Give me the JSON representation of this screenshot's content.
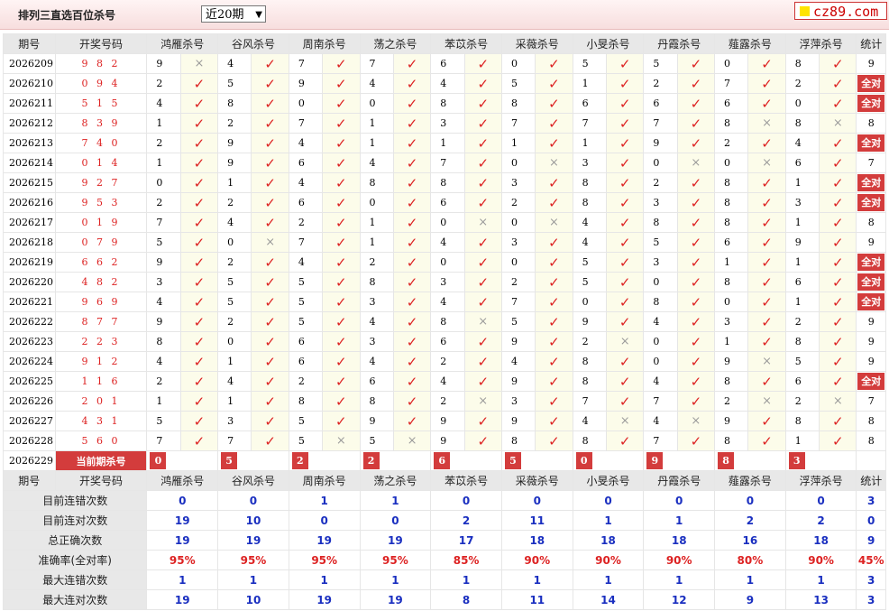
{
  "header": {
    "title": "排列三直选百位杀号",
    "period_select": "近20期",
    "logo": "cz89.com"
  },
  "columns": {
    "period": "期号",
    "draw": "开奖号码",
    "stat": "统计",
    "experts": [
      "鸿雁杀号",
      "谷风杀号",
      "周南杀号",
      "荡之杀号",
      "苯苡杀号",
      "采薇杀号",
      "小旻杀号",
      "丹霞杀号",
      "薤露杀号",
      "浮萍杀号"
    ]
  },
  "marks": {
    "correct": "✓",
    "wrong": "×",
    "all_correct": "全对"
  },
  "rows": [
    {
      "period": "2026209",
      "draw": "9 8 2",
      "kills": [
        "9",
        "4",
        "7",
        "7",
        "6",
        "0",
        "5",
        "5",
        "0",
        "8"
      ],
      "hits": [
        0,
        1,
        1,
        1,
        1,
        1,
        1,
        1,
        1,
        1
      ],
      "total": "9"
    },
    {
      "period": "2026210",
      "draw": "0 9 4",
      "kills": [
        "2",
        "5",
        "9",
        "4",
        "4",
        "5",
        "1",
        "2",
        "7",
        "2"
      ],
      "hits": [
        1,
        1,
        1,
        1,
        1,
        1,
        1,
        1,
        1,
        1
      ],
      "total": "全对"
    },
    {
      "period": "2026211",
      "draw": "5 1 5",
      "kills": [
        "4",
        "8",
        "0",
        "0",
        "8",
        "8",
        "6",
        "6",
        "6",
        "0"
      ],
      "hits": [
        1,
        1,
        1,
        1,
        1,
        1,
        1,
        1,
        1,
        1
      ],
      "total": "全对"
    },
    {
      "period": "2026212",
      "draw": "8 3 9",
      "kills": [
        "1",
        "2",
        "7",
        "1",
        "3",
        "7",
        "7",
        "7",
        "8",
        "8"
      ],
      "hits": [
        1,
        1,
        1,
        1,
        1,
        1,
        1,
        1,
        0,
        0
      ],
      "total": "8"
    },
    {
      "period": "2026213",
      "draw": "7 4 0",
      "kills": [
        "2",
        "9",
        "4",
        "1",
        "1",
        "1",
        "1",
        "9",
        "2",
        "4"
      ],
      "hits": [
        1,
        1,
        1,
        1,
        1,
        1,
        1,
        1,
        1,
        1
      ],
      "total": "全对"
    },
    {
      "period": "2026214",
      "draw": "0 1 4",
      "kills": [
        "1",
        "9",
        "6",
        "4",
        "7",
        "0",
        "3",
        "0",
        "0",
        "6"
      ],
      "hits": [
        1,
        1,
        1,
        1,
        1,
        0,
        1,
        0,
        0,
        1
      ],
      "total": "7"
    },
    {
      "period": "2026215",
      "draw": "9 2 7",
      "kills": [
        "0",
        "1",
        "4",
        "8",
        "8",
        "3",
        "8",
        "2",
        "8",
        "1"
      ],
      "hits": [
        1,
        1,
        1,
        1,
        1,
        1,
        1,
        1,
        1,
        1
      ],
      "total": "全对"
    },
    {
      "period": "2026216",
      "draw": "9 5 3",
      "kills": [
        "2",
        "2",
        "6",
        "0",
        "6",
        "2",
        "8",
        "3",
        "8",
        "3"
      ],
      "hits": [
        1,
        1,
        1,
        1,
        1,
        1,
        1,
        1,
        1,
        1
      ],
      "total": "全对"
    },
    {
      "period": "2026217",
      "draw": "0 1 9",
      "kills": [
        "7",
        "4",
        "2",
        "1",
        "0",
        "0",
        "4",
        "8",
        "8",
        "1"
      ],
      "hits": [
        1,
        1,
        1,
        1,
        0,
        0,
        1,
        1,
        1,
        1
      ],
      "total": "8"
    },
    {
      "period": "2026218",
      "draw": "0 7 9",
      "kills": [
        "5",
        "0",
        "7",
        "1",
        "4",
        "3",
        "4",
        "5",
        "6",
        "9"
      ],
      "hits": [
        1,
        0,
        1,
        1,
        1,
        1,
        1,
        1,
        1,
        1
      ],
      "total": "9"
    },
    {
      "period": "2026219",
      "draw": "6 6 2",
      "kills": [
        "9",
        "2",
        "4",
        "2",
        "0",
        "0",
        "5",
        "3",
        "1",
        "1"
      ],
      "hits": [
        1,
        1,
        1,
        1,
        1,
        1,
        1,
        1,
        1,
        1
      ],
      "total": "全对"
    },
    {
      "period": "2026220",
      "draw": "4 8 2",
      "kills": [
        "3",
        "5",
        "5",
        "8",
        "3",
        "2",
        "5",
        "0",
        "8",
        "6"
      ],
      "hits": [
        1,
        1,
        1,
        1,
        1,
        1,
        1,
        1,
        1,
        1
      ],
      "total": "全对"
    },
    {
      "period": "2026221",
      "draw": "9 6 9",
      "kills": [
        "4",
        "5",
        "5",
        "3",
        "4",
        "7",
        "0",
        "8",
        "0",
        "1"
      ],
      "hits": [
        1,
        1,
        1,
        1,
        1,
        1,
        1,
        1,
        1,
        1
      ],
      "total": "全对"
    },
    {
      "period": "2026222",
      "draw": "8 7 7",
      "kills": [
        "9",
        "2",
        "5",
        "4",
        "8",
        "5",
        "9",
        "4",
        "3",
        "2"
      ],
      "hits": [
        1,
        1,
        1,
        1,
        0,
        1,
        1,
        1,
        1,
        1
      ],
      "total": "9"
    },
    {
      "period": "2026223",
      "draw": "2 2 3",
      "kills": [
        "8",
        "0",
        "6",
        "3",
        "6",
        "9",
        "2",
        "0",
        "1",
        "8"
      ],
      "hits": [
        1,
        1,
        1,
        1,
        1,
        1,
        0,
        1,
        1,
        1
      ],
      "total": "9"
    },
    {
      "period": "2026224",
      "draw": "9 1 2",
      "kills": [
        "4",
        "1",
        "6",
        "4",
        "2",
        "4",
        "8",
        "0",
        "9",
        "5"
      ],
      "hits": [
        1,
        1,
        1,
        1,
        1,
        1,
        1,
        1,
        0,
        1
      ],
      "total": "9"
    },
    {
      "period": "2026225",
      "draw": "1 1 6",
      "kills": [
        "2",
        "4",
        "2",
        "6",
        "4",
        "9",
        "8",
        "4",
        "8",
        "6"
      ],
      "hits": [
        1,
        1,
        1,
        1,
        1,
        1,
        1,
        1,
        1,
        1
      ],
      "total": "全对"
    },
    {
      "period": "2026226",
      "draw": "2 0 1",
      "kills": [
        "1",
        "1",
        "8",
        "8",
        "2",
        "3",
        "7",
        "7",
        "2",
        "2"
      ],
      "hits": [
        1,
        1,
        1,
        1,
        0,
        1,
        1,
        1,
        0,
        0
      ],
      "total": "7"
    },
    {
      "period": "2026227",
      "draw": "4 3 1",
      "kills": [
        "5",
        "3",
        "5",
        "9",
        "9",
        "9",
        "4",
        "4",
        "9",
        "8"
      ],
      "hits": [
        1,
        1,
        1,
        1,
        1,
        1,
        0,
        0,
        1,
        1
      ],
      "total": "8"
    },
    {
      "period": "2026228",
      "draw": "5 6 0",
      "kills": [
        "7",
        "7",
        "5",
        "5",
        "9",
        "8",
        "8",
        "7",
        "8",
        "1"
      ],
      "hits": [
        1,
        1,
        0,
        0,
        1,
        1,
        1,
        1,
        1,
        1
      ],
      "total": "8"
    }
  ],
  "current": {
    "period": "2026229",
    "label": "当前期杀号",
    "kills": [
      "0",
      "5",
      "2",
      "2",
      "6",
      "5",
      "0",
      "9",
      "8",
      "3"
    ]
  },
  "stats": [
    {
      "label": "目前连错次数",
      "values": [
        "0",
        "0",
        "1",
        "1",
        "0",
        "0",
        "0",
        "0",
        "0",
        "0"
      ],
      "total": "3",
      "red": false
    },
    {
      "label": "目前连对次数",
      "values": [
        "19",
        "10",
        "0",
        "0",
        "2",
        "11",
        "1",
        "1",
        "2",
        "2"
      ],
      "total": "0",
      "red": false
    },
    {
      "label": "总正确次数",
      "values": [
        "19",
        "19",
        "19",
        "19",
        "17",
        "18",
        "18",
        "18",
        "16",
        "18"
      ],
      "total": "9",
      "red": false
    },
    {
      "label": "准确率(全对率)",
      "values": [
        "95%",
        "95%",
        "95%",
        "95%",
        "85%",
        "90%",
        "90%",
        "90%",
        "80%",
        "90%"
      ],
      "total": "45%",
      "red": true
    },
    {
      "label": "最大连错次数",
      "values": [
        "1",
        "1",
        "1",
        "1",
        "1",
        "1",
        "1",
        "1",
        "1",
        "1"
      ],
      "total": "3",
      "red": false
    },
    {
      "label": "最大连对次数",
      "values": [
        "19",
        "10",
        "19",
        "19",
        "8",
        "11",
        "14",
        "12",
        "9",
        "13"
      ],
      "total": "3",
      "red": false
    }
  ]
}
